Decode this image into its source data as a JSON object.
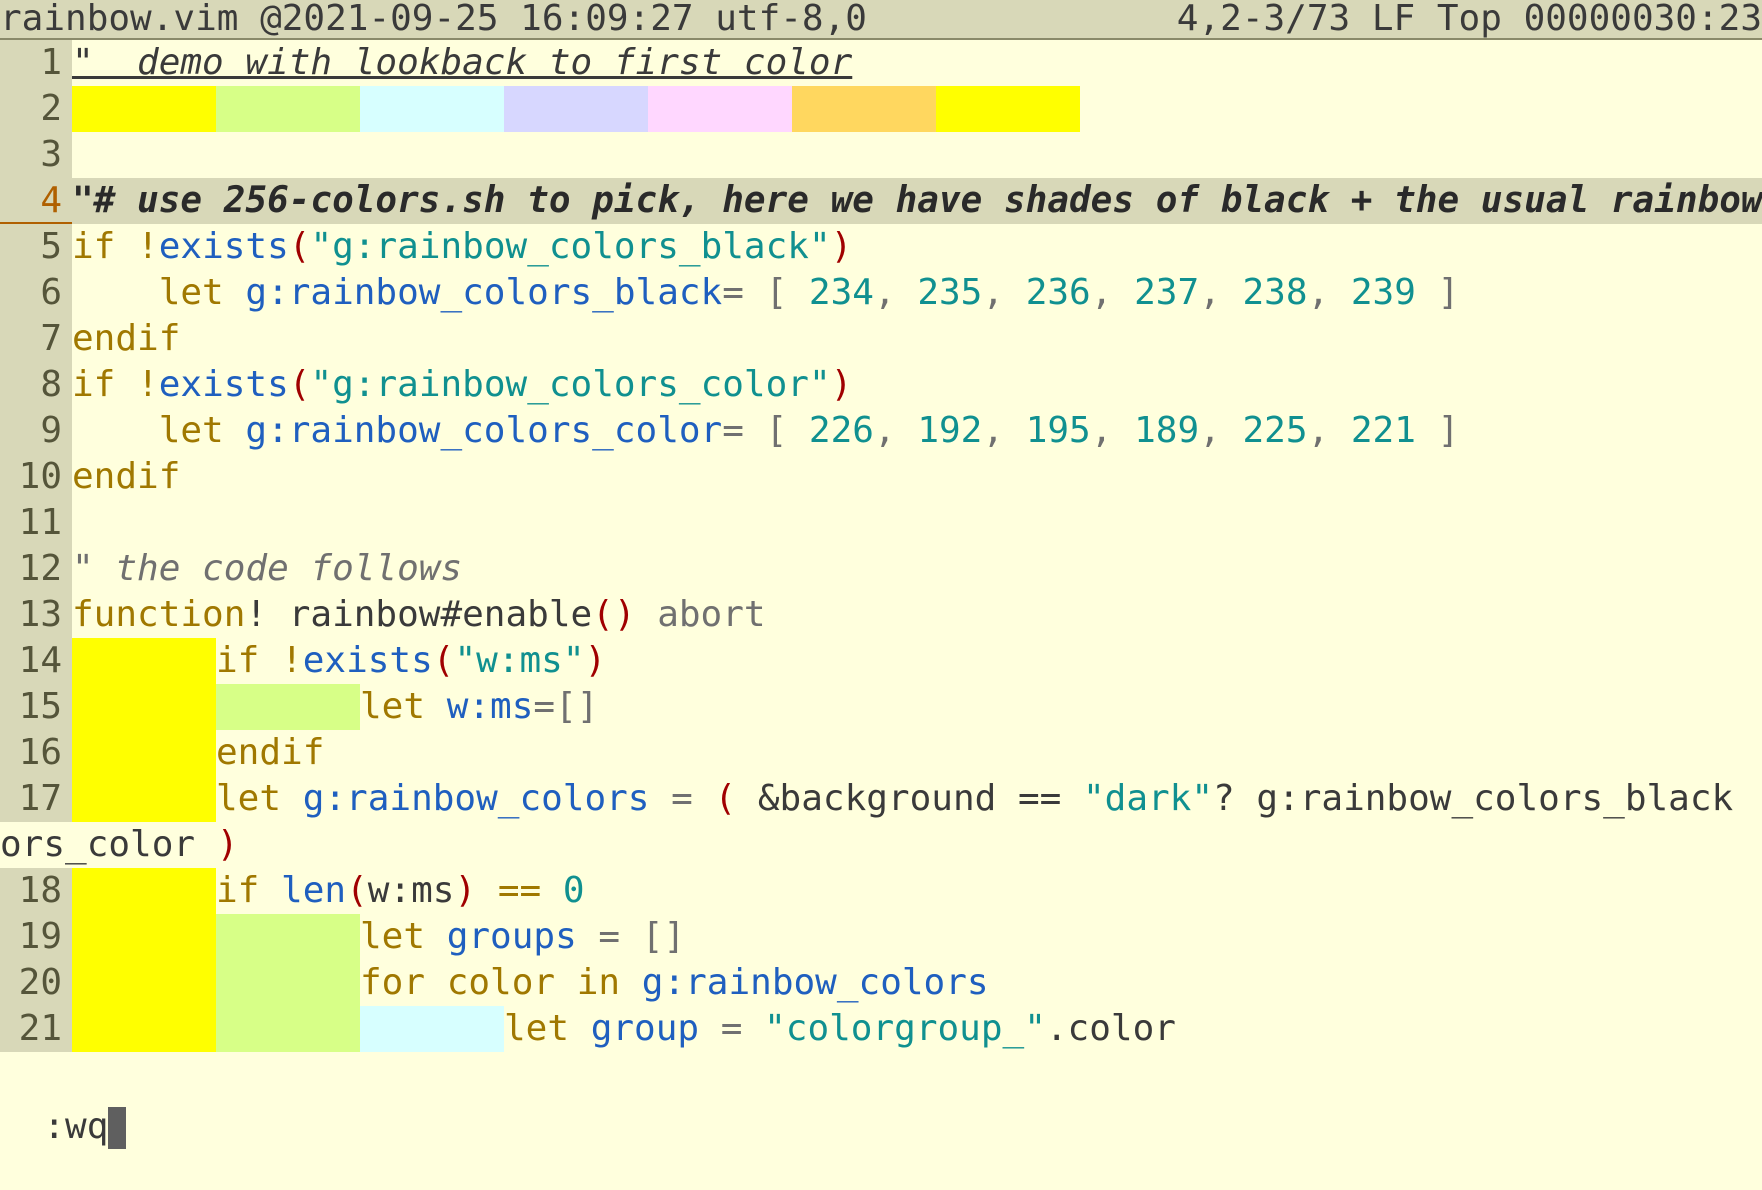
{
  "statusbar": {
    "left": "rainbow.vim @2021-09-25 16:09:27 utf-8,0",
    "right": "4,2-3/73 LF Top 00000030:23"
  },
  "colors": {
    "background": "#ffffdd",
    "rainbow": [
      "#ffff00",
      "#d7ff87",
      "#d7ffff",
      "#d7d7ff",
      "#ffd7ff",
      "#ffd75f",
      "#ffff00"
    ]
  },
  "lines": {
    "l1": {
      "num": "1",
      "text": "\"  demo with lookback to first color"
    },
    "l2": {
      "num": "2"
    },
    "l3": {
      "num": "3"
    },
    "l4": {
      "num": "4",
      "text": "\"# use 256-colors.sh to pick, here we have shades of black + the usual rainbow"
    },
    "l5": {
      "num": "5",
      "a": "if",
      "b": " !",
      "c": "exists",
      "d": "(",
      "e": "\"g:rainbow_colors_black\"",
      "f": ")"
    },
    "l6": {
      "num": "6",
      "a": "    let ",
      "b": "g:rainbow_colors_black",
      "c": "= [ ",
      "n1": "234",
      "n2": "235",
      "n3": "236",
      "n4": "237",
      "n5": "238",
      "n6": "239",
      "sep": ", ",
      "end": " ]"
    },
    "l7": {
      "num": "7",
      "a": "endif"
    },
    "l8": {
      "num": "8",
      "a": "if",
      "b": " !",
      "c": "exists",
      "d": "(",
      "e": "\"g:rainbow_colors_color\"",
      "f": ")"
    },
    "l9": {
      "num": "9",
      "a": "    let ",
      "b": "g:rainbow_colors_color",
      "c": "= [ ",
      "n1": "226",
      "n2": "192",
      "n3": "195",
      "n4": "189",
      "n5": "225",
      "n6": "221",
      "sep": ", ",
      "end": " ]"
    },
    "l10": {
      "num": "10",
      "a": "endif"
    },
    "l11": {
      "num": "11"
    },
    "l12": {
      "num": "12",
      "text": "\" the code follows"
    },
    "l13": {
      "num": "13",
      "a": "function",
      "b": "! rainbow#enable",
      "c": "()",
      "d": " abort"
    },
    "l14": {
      "num": "14",
      "a": "if",
      "b": " !",
      "c": "exists",
      "d": "(",
      "e": "\"w:ms\"",
      "f": ")"
    },
    "l15": {
      "num": "15",
      "a": "let ",
      "b": "w:ms",
      "c": "=[]"
    },
    "l16": {
      "num": "16",
      "a": "endif"
    },
    "l17": {
      "num": "17",
      "a": "let ",
      "b": "g:rainbow_colors",
      "c": " = ",
      "d": "(",
      "e": " &background == ",
      "f": "\"dark\"",
      "g": "? g:rainbow_colors_black : g:rainbow_col"
    },
    "l17w": {
      "a": "ors_color ",
      "b": ")"
    },
    "l18": {
      "num": "18",
      "a": "if ",
      "b": "len",
      "c": "(",
      "d": "w:ms",
      "e": ")",
      "f": " == ",
      "g": "0"
    },
    "l19": {
      "num": "19",
      "a": "let ",
      "b": "groups",
      "c": " = []"
    },
    "l20": {
      "num": "20",
      "a": "for ",
      "b": "color",
      "c": " in ",
      "d": "g:rainbow_colors"
    },
    "l21": {
      "num": "21",
      "a": "let ",
      "b": "group",
      "c": " = ",
      "d": "\"colorgroup_\"",
      "e": ".color"
    }
  },
  "cmdline": {
    "text": ":wq"
  }
}
